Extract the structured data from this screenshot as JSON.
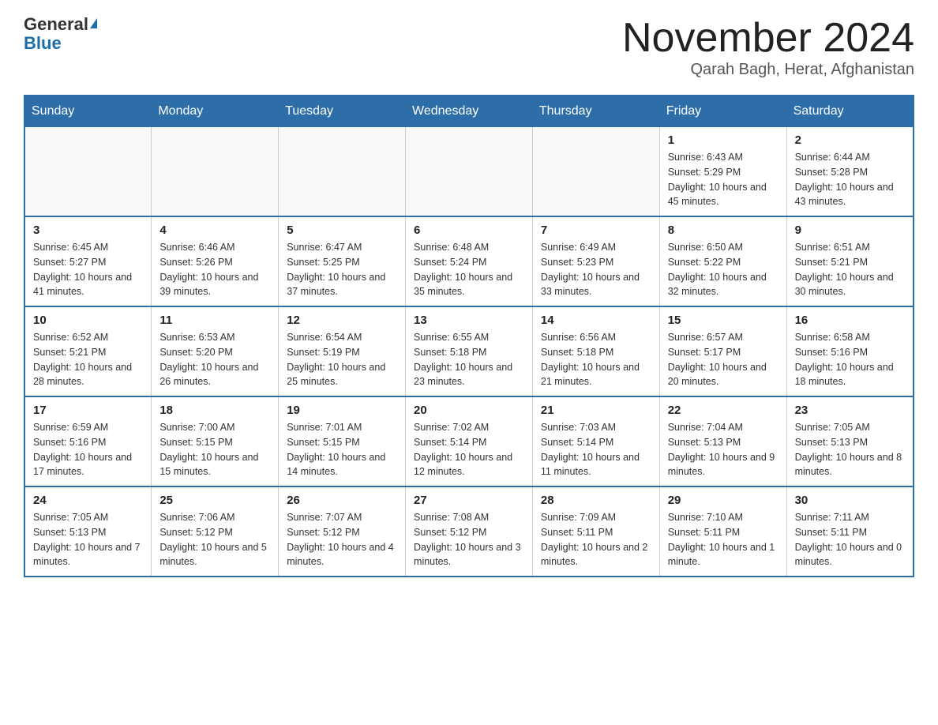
{
  "header": {
    "logo_general": "General",
    "logo_blue": "Blue",
    "month_title": "November 2024",
    "subtitle": "Qarah Bagh, Herat, Afghanistan"
  },
  "days_of_week": [
    "Sunday",
    "Monday",
    "Tuesday",
    "Wednesday",
    "Thursday",
    "Friday",
    "Saturday"
  ],
  "weeks": [
    [
      {
        "day": "",
        "info": ""
      },
      {
        "day": "",
        "info": ""
      },
      {
        "day": "",
        "info": ""
      },
      {
        "day": "",
        "info": ""
      },
      {
        "day": "",
        "info": ""
      },
      {
        "day": "1",
        "info": "Sunrise: 6:43 AM\nSunset: 5:29 PM\nDaylight: 10 hours and 45 minutes."
      },
      {
        "day": "2",
        "info": "Sunrise: 6:44 AM\nSunset: 5:28 PM\nDaylight: 10 hours and 43 minutes."
      }
    ],
    [
      {
        "day": "3",
        "info": "Sunrise: 6:45 AM\nSunset: 5:27 PM\nDaylight: 10 hours and 41 minutes."
      },
      {
        "day": "4",
        "info": "Sunrise: 6:46 AM\nSunset: 5:26 PM\nDaylight: 10 hours and 39 minutes."
      },
      {
        "day": "5",
        "info": "Sunrise: 6:47 AM\nSunset: 5:25 PM\nDaylight: 10 hours and 37 minutes."
      },
      {
        "day": "6",
        "info": "Sunrise: 6:48 AM\nSunset: 5:24 PM\nDaylight: 10 hours and 35 minutes."
      },
      {
        "day": "7",
        "info": "Sunrise: 6:49 AM\nSunset: 5:23 PM\nDaylight: 10 hours and 33 minutes."
      },
      {
        "day": "8",
        "info": "Sunrise: 6:50 AM\nSunset: 5:22 PM\nDaylight: 10 hours and 32 minutes."
      },
      {
        "day": "9",
        "info": "Sunrise: 6:51 AM\nSunset: 5:21 PM\nDaylight: 10 hours and 30 minutes."
      }
    ],
    [
      {
        "day": "10",
        "info": "Sunrise: 6:52 AM\nSunset: 5:21 PM\nDaylight: 10 hours and 28 minutes."
      },
      {
        "day": "11",
        "info": "Sunrise: 6:53 AM\nSunset: 5:20 PM\nDaylight: 10 hours and 26 minutes."
      },
      {
        "day": "12",
        "info": "Sunrise: 6:54 AM\nSunset: 5:19 PM\nDaylight: 10 hours and 25 minutes."
      },
      {
        "day": "13",
        "info": "Sunrise: 6:55 AM\nSunset: 5:18 PM\nDaylight: 10 hours and 23 minutes."
      },
      {
        "day": "14",
        "info": "Sunrise: 6:56 AM\nSunset: 5:18 PM\nDaylight: 10 hours and 21 minutes."
      },
      {
        "day": "15",
        "info": "Sunrise: 6:57 AM\nSunset: 5:17 PM\nDaylight: 10 hours and 20 minutes."
      },
      {
        "day": "16",
        "info": "Sunrise: 6:58 AM\nSunset: 5:16 PM\nDaylight: 10 hours and 18 minutes."
      }
    ],
    [
      {
        "day": "17",
        "info": "Sunrise: 6:59 AM\nSunset: 5:16 PM\nDaylight: 10 hours and 17 minutes."
      },
      {
        "day": "18",
        "info": "Sunrise: 7:00 AM\nSunset: 5:15 PM\nDaylight: 10 hours and 15 minutes."
      },
      {
        "day": "19",
        "info": "Sunrise: 7:01 AM\nSunset: 5:15 PM\nDaylight: 10 hours and 14 minutes."
      },
      {
        "day": "20",
        "info": "Sunrise: 7:02 AM\nSunset: 5:14 PM\nDaylight: 10 hours and 12 minutes."
      },
      {
        "day": "21",
        "info": "Sunrise: 7:03 AM\nSunset: 5:14 PM\nDaylight: 10 hours and 11 minutes."
      },
      {
        "day": "22",
        "info": "Sunrise: 7:04 AM\nSunset: 5:13 PM\nDaylight: 10 hours and 9 minutes."
      },
      {
        "day": "23",
        "info": "Sunrise: 7:05 AM\nSunset: 5:13 PM\nDaylight: 10 hours and 8 minutes."
      }
    ],
    [
      {
        "day": "24",
        "info": "Sunrise: 7:05 AM\nSunset: 5:13 PM\nDaylight: 10 hours and 7 minutes."
      },
      {
        "day": "25",
        "info": "Sunrise: 7:06 AM\nSunset: 5:12 PM\nDaylight: 10 hours and 5 minutes."
      },
      {
        "day": "26",
        "info": "Sunrise: 7:07 AM\nSunset: 5:12 PM\nDaylight: 10 hours and 4 minutes."
      },
      {
        "day": "27",
        "info": "Sunrise: 7:08 AM\nSunset: 5:12 PM\nDaylight: 10 hours and 3 minutes."
      },
      {
        "day": "28",
        "info": "Sunrise: 7:09 AM\nSunset: 5:11 PM\nDaylight: 10 hours and 2 minutes."
      },
      {
        "day": "29",
        "info": "Sunrise: 7:10 AM\nSunset: 5:11 PM\nDaylight: 10 hours and 1 minute."
      },
      {
        "day": "30",
        "info": "Sunrise: 7:11 AM\nSunset: 5:11 PM\nDaylight: 10 hours and 0 minutes."
      }
    ]
  ]
}
